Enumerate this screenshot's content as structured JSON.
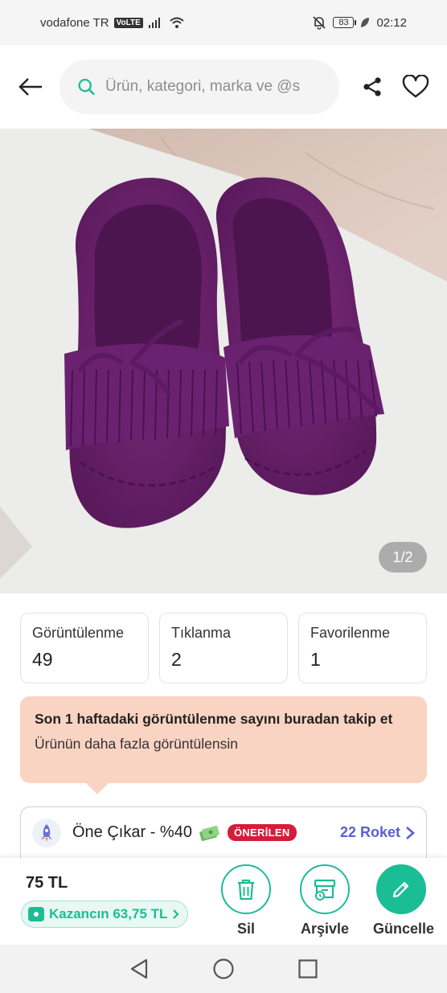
{
  "status_bar": {
    "carrier": "vodafone TR",
    "volte": "VoLTE",
    "battery": "83",
    "time": "02:12"
  },
  "header": {
    "search_placeholder": "Ürün, kategori, marka ve @s"
  },
  "product": {
    "image_counter": "1/2",
    "image_subject": "purple suede moccasin shoes with fringe and bow"
  },
  "stats": [
    {
      "label": "Görüntülenme",
      "value": "49"
    },
    {
      "label": "Tıklanma",
      "value": "2"
    },
    {
      "label": "Favorilenme",
      "value": "1"
    }
  ],
  "info_banner": {
    "title": "Son 1 haftadaki görüntülenme sayını buradan takip et",
    "subtitle": "Ürünün daha fazla görüntülensin"
  },
  "promote": {
    "title": "Öne Çıkar - %40",
    "badge": "ÖNERİLEN",
    "rocket_cost": "22 Roket"
  },
  "action_bar": {
    "price": "75 TL",
    "earnings": "Kazancın 63,75 TL",
    "delete_label": "Sil",
    "archive_label": "Arşivle",
    "update_label": "Güncelle"
  },
  "colors": {
    "accent": "#1bbd95",
    "banner_bg": "#fad4c3",
    "badge_red": "#d41d3a",
    "rocket_blue": "#5b5fd6",
    "shoe_purple": "#6e1f6e"
  }
}
